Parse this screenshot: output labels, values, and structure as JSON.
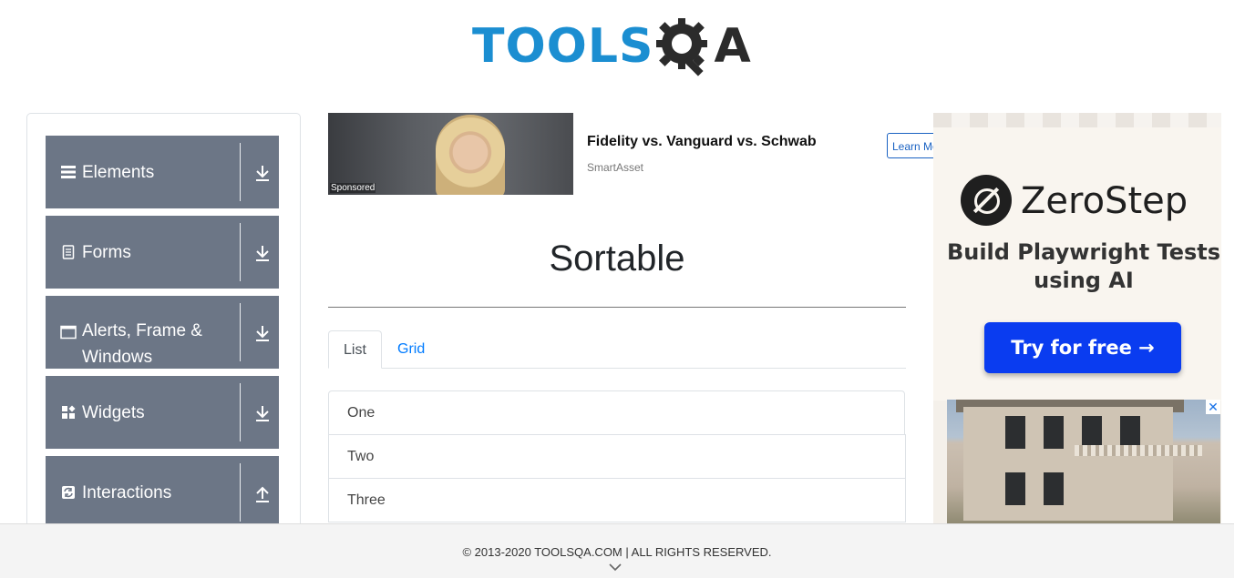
{
  "logo": {
    "part1": "TOOLS",
    "part2": "A"
  },
  "sidebar": {
    "groups": [
      {
        "label": "Elements",
        "icon": "hamburger-icon",
        "state": "collapsed"
      },
      {
        "label": "Forms",
        "icon": "document-icon",
        "state": "collapsed"
      },
      {
        "label": "Alerts, Frame & Windows",
        "icon": "window-icon",
        "state": "collapsed"
      },
      {
        "label": "Widgets",
        "icon": "widgets-icon",
        "state": "collapsed"
      },
      {
        "label": "Interactions",
        "icon": "interactions-icon",
        "state": "expanded"
      }
    ]
  },
  "ad": {
    "title": "Fidelity vs. Vanguard vs. Schwab",
    "source": "SmartAsset",
    "sponsored": "Sponsored",
    "button": "Learn More"
  },
  "main": {
    "title": "Sortable",
    "tabs": [
      {
        "label": "List"
      },
      {
        "label": "Grid"
      }
    ],
    "items": [
      "One",
      "Two",
      "Three"
    ]
  },
  "side_ad": {
    "brand": "ZeroStep",
    "tagline": "Build Playwright Tests using AI",
    "button": "Try for free →",
    "close": "✕"
  },
  "footer": {
    "text": "© 2013-2020 TOOLSQA.COM | ALL RIGHTS RESERVED."
  },
  "colors": {
    "sidebar_bg": "#6c7686",
    "logo_blue": "#1b8ed1",
    "link_blue": "#007bff",
    "cta_blue": "#0a3cf0"
  }
}
